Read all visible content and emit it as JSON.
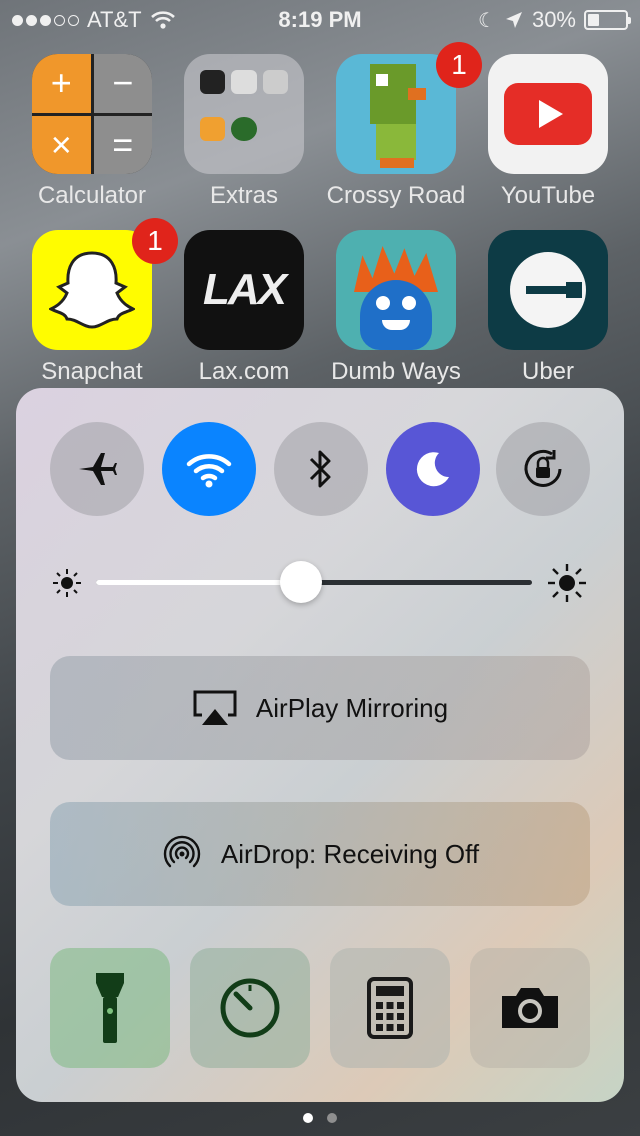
{
  "status_bar": {
    "carrier": "AT&T",
    "time": "8:19 PM",
    "battery_percent": "30%",
    "battery_level": 0.3,
    "signal_bars_filled": 3,
    "signal_bars_total": 5
  },
  "apps": [
    {
      "label": "Calculator",
      "badge": ""
    },
    {
      "label": "Extras",
      "badge": ""
    },
    {
      "label": "Crossy Road",
      "badge": "1"
    },
    {
      "label": "YouTube",
      "badge": ""
    },
    {
      "label": "Snapchat",
      "badge": "1"
    },
    {
      "label": "Lax.com",
      "badge": ""
    },
    {
      "label": "Dumb Ways",
      "badge": ""
    },
    {
      "label": "Uber",
      "badge": ""
    }
  ],
  "calculator_glyphs": [
    "+",
    "−",
    "×",
    "="
  ],
  "lax_logo_text": "LAX",
  "control_center": {
    "toggles": [
      {
        "icon": "airplane-icon",
        "state": "off"
      },
      {
        "icon": "wifi-icon",
        "state": "on"
      },
      {
        "icon": "bluetooth-icon",
        "state": "off"
      },
      {
        "icon": "moon-icon",
        "state": "on"
      },
      {
        "icon": "rotation-lock-icon",
        "state": "off"
      }
    ],
    "brightness": 0.47,
    "airplay_label": "AirPlay Mirroring",
    "airdrop_label": "AirDrop: Receiving Off",
    "quick_actions": [
      "flashlight-icon",
      "timer-icon",
      "calculator-icon",
      "camera-icon"
    ]
  },
  "colors": {
    "wifi_on": "#0a84ff",
    "dnd_on": "#5856d6",
    "badge": "#e0241b"
  },
  "page_dots": {
    "count": 2,
    "active": 0
  }
}
